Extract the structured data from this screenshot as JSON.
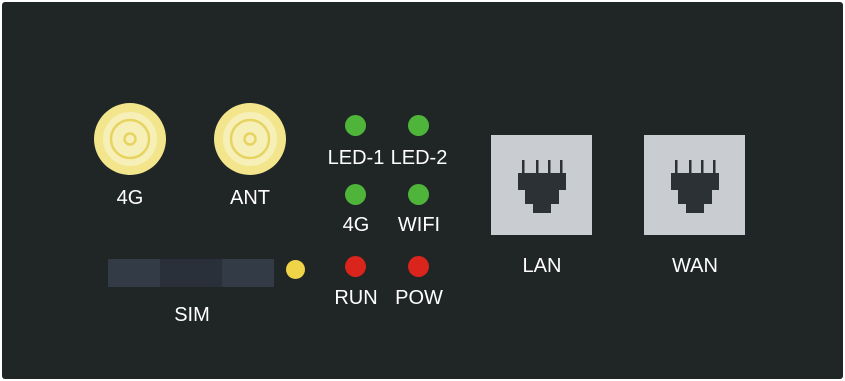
{
  "antennas": [
    {
      "label": "4G",
      "color": "#f2e58c",
      "core": "#f6f0b8"
    },
    {
      "label": "ANT",
      "color": "#f2e58c",
      "core": "#f6f0b8"
    }
  ],
  "leds": {
    "led1": {
      "label": "LED-1",
      "color": "#4fb53a"
    },
    "led2": {
      "label": "LED-2",
      "color": "#4fb53a"
    },
    "g4": {
      "label": "4G",
      "color": "#4fb53a"
    },
    "wifi": {
      "label": "WIFI",
      "color": "#4fb53a"
    },
    "run": {
      "label": "RUN",
      "color": "#d9251c"
    },
    "pow": {
      "label": "POW",
      "color": "#d9251c"
    }
  },
  "sim": {
    "label": "SIM",
    "indicator_color": "#f0d447",
    "slot_color": "#333b46"
  },
  "ports": {
    "lan": {
      "label": "LAN",
      "color": "#c9ccd1",
      "jack_color": "#2b3134"
    },
    "wan": {
      "label": "WAN",
      "color": "#c9ccd1",
      "jack_color": "#2b3134"
    }
  },
  "panel_color": "#202526"
}
